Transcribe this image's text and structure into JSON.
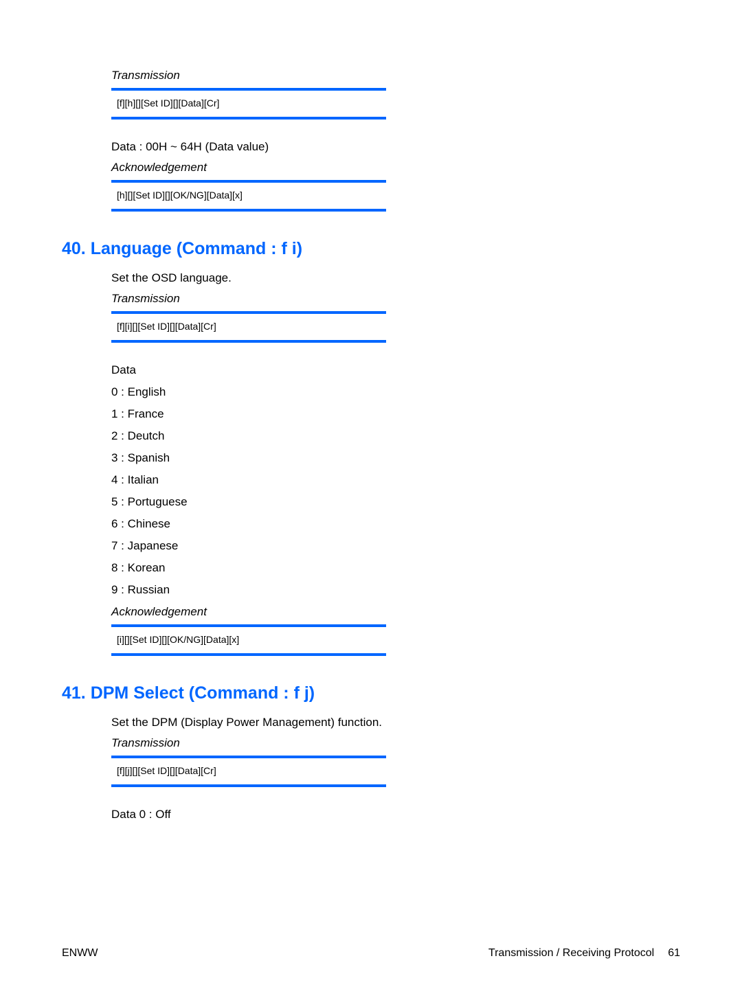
{
  "section1": {
    "transmission_label": "Transmission",
    "transmission_code": "[f][h][][Set ID][][Data][Cr]",
    "data_range": "Data : 00H ~ 64H (Data value)",
    "acknowledgement_label": "Acknowledgement",
    "acknowledgement_code": "[h][][Set ID][][OK/NG][Data][x]"
  },
  "section2": {
    "heading": "40. Language (Command : f i)",
    "description": "Set the OSD language.",
    "transmission_label": "Transmission",
    "transmission_code": "[f][i][][Set ID][][Data][Cr]",
    "data_label": "Data",
    "data_values": [
      "0 : English",
      "1 : France",
      "2 : Deutch",
      "3 : Spanish",
      "4 : Italian",
      "5 : Portuguese",
      "6 : Chinese",
      "7 : Japanese",
      "8 : Korean",
      "9 : Russian"
    ],
    "acknowledgement_label": "Acknowledgement",
    "acknowledgement_code": "[i][][Set ID][][OK/NG][Data][x]"
  },
  "section3": {
    "heading": "41. DPM Select (Command : f j)",
    "description": "Set the DPM (Display Power Management) function.",
    "transmission_label": "Transmission",
    "transmission_code": "[f][j][][Set ID][][Data][Cr]",
    "data_value": "Data 0 : Off"
  },
  "footer": {
    "left": "ENWW",
    "right_text": "Transmission / Receiving Protocol",
    "page_number": "61"
  }
}
